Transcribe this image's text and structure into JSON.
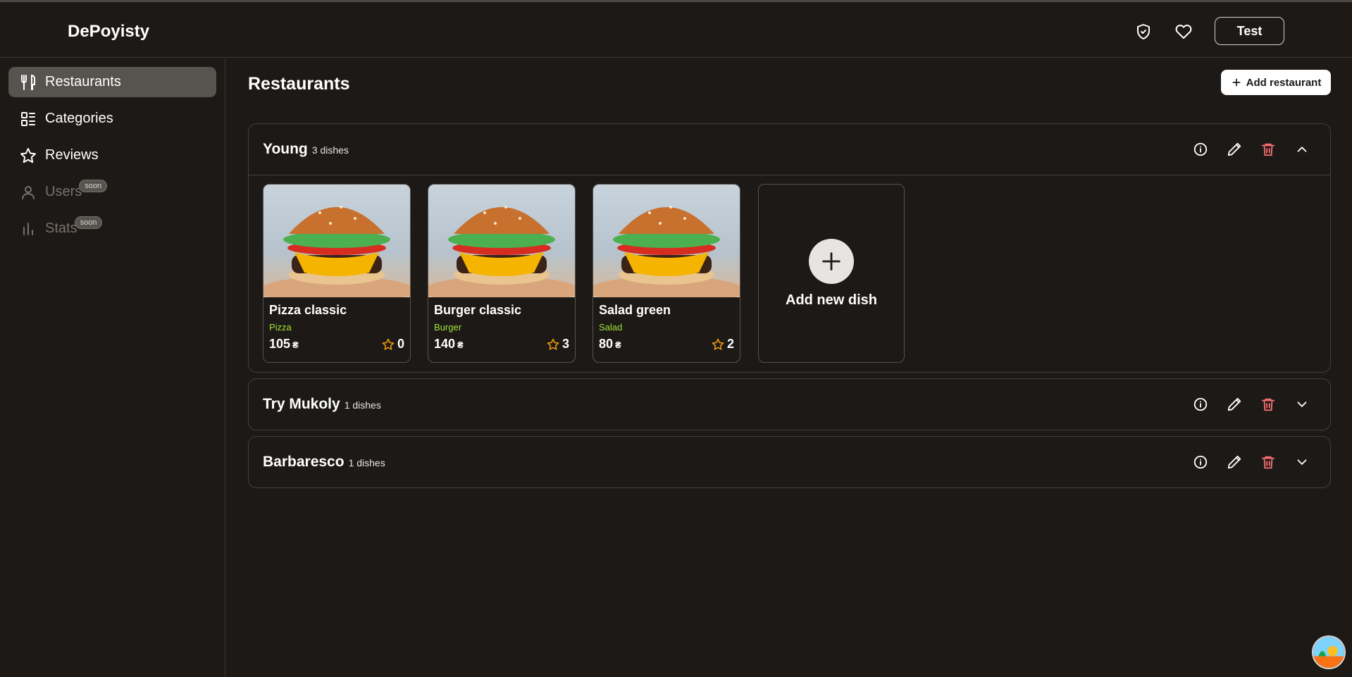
{
  "app": {
    "title": "DePoyisty"
  },
  "header": {
    "user_label": "Test",
    "icons": [
      "shield-check-icon",
      "heart-icon"
    ]
  },
  "sidebar": {
    "items": [
      {
        "label": "Restaurants",
        "icon": "utensils-icon",
        "active": true,
        "disabled": false,
        "badge": ""
      },
      {
        "label": "Categories",
        "icon": "list-icon",
        "active": false,
        "disabled": false,
        "badge": ""
      },
      {
        "label": "Reviews",
        "icon": "star-icon",
        "active": false,
        "disabled": false,
        "badge": ""
      },
      {
        "label": "Users",
        "icon": "user-icon",
        "active": false,
        "disabled": true,
        "badge": "soon"
      },
      {
        "label": "Stats",
        "icon": "bar-chart-icon",
        "active": false,
        "disabled": true,
        "badge": "soon"
      }
    ]
  },
  "main": {
    "title": "Restaurants",
    "add_button": "Add restaurant",
    "restaurants": [
      {
        "name": "Young",
        "count": "3 dishes",
        "expanded": true,
        "dishes": [
          {
            "name": "Pizza classic",
            "category": "Pizza",
            "price": "105",
            "currency": "₴",
            "rating": "0"
          },
          {
            "name": "Burger classic",
            "category": "Burger",
            "price": "140",
            "currency": "₴",
            "rating": "3"
          },
          {
            "name": "Salad green",
            "category": "Salad",
            "price": "80",
            "currency": "₴",
            "rating": "2"
          }
        ],
        "add_dish_label": "Add new dish"
      },
      {
        "name": "Try Mukoly",
        "count": "1 dishes",
        "expanded": false
      },
      {
        "name": "Barbaresco",
        "count": "1 dishes",
        "expanded": false
      }
    ]
  },
  "colors": {
    "background": "#1c1917",
    "active_nav": "#57534e",
    "category_green": "#a3e635",
    "star_gold": "#f59e0b",
    "delete_red": "#f87171"
  }
}
